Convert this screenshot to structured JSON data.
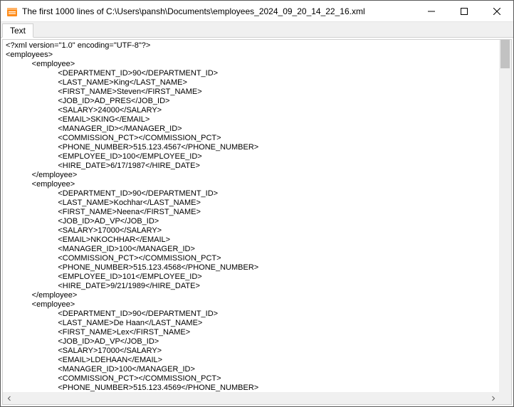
{
  "window": {
    "title": "The first 1000 lines of C:\\Users\\pansh\\Documents\\employees_2024_09_20_14_22_16.xml"
  },
  "tabs": {
    "text_label": "Text"
  },
  "xml": {
    "declaration": "<?xml version=\"1.0\" encoding=\"UTF-8\"?>",
    "root_open": "<employees>",
    "emp_open": "<employee>",
    "emp_close": "</employee>",
    "indent_emp": "            ",
    "indent_field": "                        ",
    "records": [
      {
        "DEPARTMENT_ID": "90",
        "LAST_NAME": "King",
        "FIRST_NAME": "Steven",
        "JOB_ID": "AD_PRES",
        "SALARY": "24000",
        "EMAIL": "SKING",
        "MANAGER_ID": "",
        "COMMISSION_PCT": "",
        "PHONE_NUMBER": "515.123.4567",
        "EMPLOYEE_ID": "100",
        "HIRE_DATE": "6/17/1987"
      },
      {
        "DEPARTMENT_ID": "90",
        "LAST_NAME": "Kochhar",
        "FIRST_NAME": "Neena",
        "JOB_ID": "AD_VP",
        "SALARY": "17000",
        "EMAIL": "NKOCHHAR",
        "MANAGER_ID": "100",
        "COMMISSION_PCT": "",
        "PHONE_NUMBER": "515.123.4568",
        "EMPLOYEE_ID": "101",
        "HIRE_DATE": "9/21/1989"
      },
      {
        "DEPARTMENT_ID": "90",
        "LAST_NAME": "De Haan",
        "FIRST_NAME": "Lex",
        "JOB_ID": "AD_VP",
        "SALARY": "17000",
        "EMAIL": "LDEHAAN",
        "MANAGER_ID": "100",
        "COMMISSION_PCT": "",
        "PHONE_NUMBER": "515.123.4569"
      }
    ],
    "field_order": [
      "DEPARTMENT_ID",
      "LAST_NAME",
      "FIRST_NAME",
      "JOB_ID",
      "SALARY",
      "EMAIL",
      "MANAGER_ID",
      "COMMISSION_PCT",
      "PHONE_NUMBER",
      "EMPLOYEE_ID",
      "HIRE_DATE"
    ],
    "special_order_record_0": [
      "DEPARTMENT_ID",
      "LAST_NAME",
      "FIRST_NAME",
      "JOB_ID",
      "SALARY",
      "EMAIL",
      "MANAGER_ID",
      "COMMISSION_PCT",
      "PHONE_NUMBER",
      "EMPLOYEE_ID",
      "HIRE_DATE"
    ]
  }
}
